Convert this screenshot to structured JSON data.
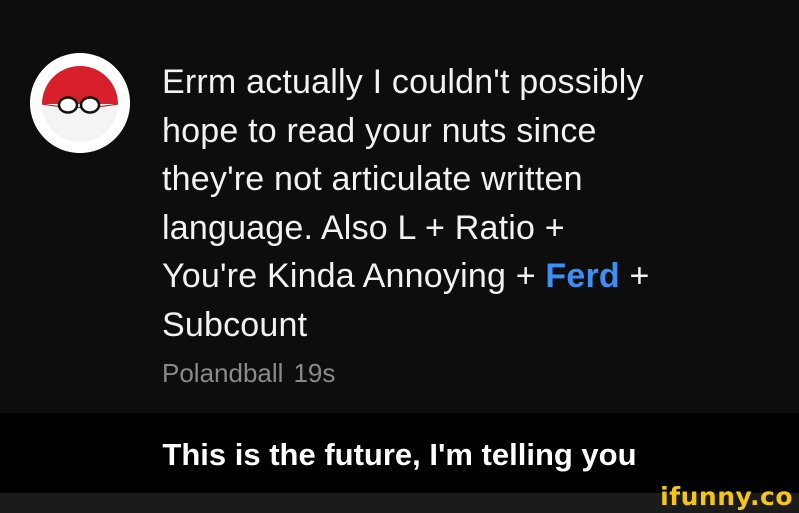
{
  "comment": {
    "line1": "Errm actually I couldn't possibly",
    "line2": "hope to read your nuts since",
    "line3": "they're not articulate written",
    "line4": "language. Also L + Ratio +",
    "line5_pre": "You're Kinda Annoying + ",
    "mention": "Ferd",
    "line5_post": " +",
    "line6": "Subcount",
    "author": "Polandball",
    "timestamp": "19s",
    "avatar_icon": "polandball-avatar-icon"
  },
  "caption": "This is the future, I'm telling you",
  "watermark": "ifunny.co",
  "colors": {
    "mention": "#3c8ff5",
    "avatar_red": "#d8202c",
    "watermark": "#f5c518"
  }
}
